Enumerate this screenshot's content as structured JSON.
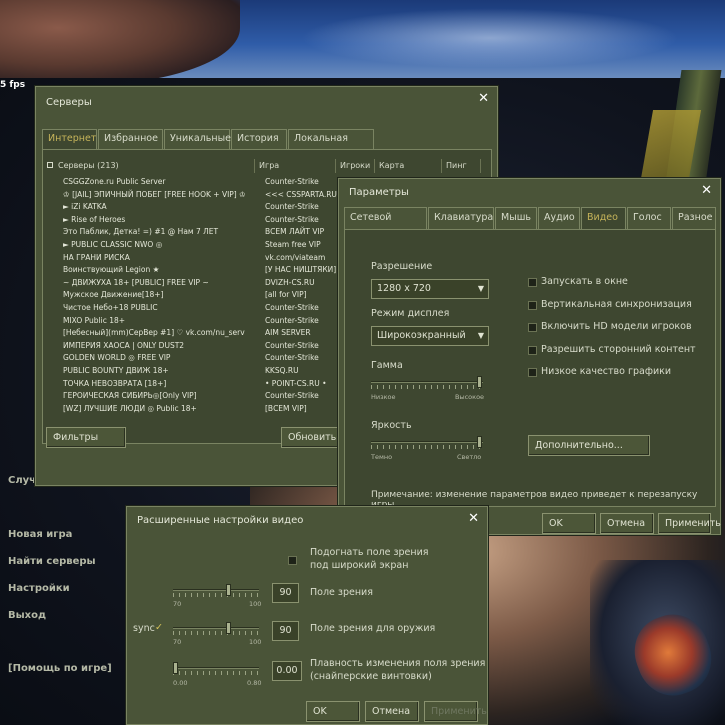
{
  "hud": {
    "fps": "5 fps"
  },
  "main_menu": {
    "items": [
      "Новая игра",
      "Найти серверы",
      "Настройки",
      "Выход"
    ],
    "help": "[Помощь по игре]",
    "partial": "Случа"
  },
  "servers": {
    "title": "Серверы",
    "tabs": [
      "Интернет",
      "Избранное",
      "Уникальные",
      "История",
      "Локальная сеть"
    ],
    "active_tab": "Интернет",
    "columns": {
      "servers": "Серверы (213)",
      "game": "Игра",
      "players": "Игроки",
      "map": "Карта",
      "ping": "Пинг"
    },
    "rows": [
      {
        "name": "CSGGZone.ru Public Server",
        "game": "Counter-Strike"
      },
      {
        "name": "♔ [JAIL] ЭПИЧНЫЙ ПОБЕГ [FREE HOOK + VIP] ♔",
        "game": "<<< CSSPARTA.RU ..."
      },
      {
        "name": "► iZi KATKA",
        "game": "Counter-Strike"
      },
      {
        "name": "► Rise of Heroes",
        "game": "Counter-Strike"
      },
      {
        "name": "Это Паблик, Детка! =) #1 @ Нам 7 ЛЕТ",
        "game": "ВСЕМ ЛАЙТ VIP"
      },
      {
        "name": "► PUBLIC CLASSIC NWO ◎",
        "game": "Steam free VIP"
      },
      {
        "name": "НА ГРАНИ РИСКА",
        "game": "vk.com/viateam"
      },
      {
        "name": "Воинствующий Legion ★",
        "game": "[У НАС НИШТЯКИ]"
      },
      {
        "name": "~ ДВИЖУХА 18+ [PUBLIC] FREE VIP ~",
        "game": "DVIZH-CS.RU"
      },
      {
        "name": "Мужское Движение[18+]",
        "game": "[all for VIP]"
      },
      {
        "name": "Чистое Небо+18 PUBLIC",
        "game": "Counter-Strike"
      },
      {
        "name": "MIXO Public 18+",
        "game": "Counter-Strike"
      },
      {
        "name": "[Небесный](mm)СерВер #1] ♡ vk.com/nu_serv",
        "game": "AIM SERVER"
      },
      {
        "name": "ИМПЕРИЯ ХАОСА | ONLY DUST2",
        "game": "Counter-Strike"
      },
      {
        "name": "GOLDEN WORLD ◎ FREE VIP",
        "game": "Counter-Strike"
      },
      {
        "name": "PUBLIC BOUNTY ДВИЖ 18+",
        "game": "KKSQ.RU"
      },
      {
        "name": "ТОЧКА НЕВОЗВРАТА [18+]",
        "game": "• POINT-CS.RU •"
      },
      {
        "name": "ГЕРОИЧЕСКАЯ СИБИРЬ◎[Only VIP]",
        "game": "Counter-Strike"
      },
      {
        "name": "[WZ] ЛУЧШИЕ ЛЮДИ ◎ Public 18+",
        "game": "[ВСЕМ VIP]"
      }
    ],
    "filters_button": "Фильтры",
    "refresh_button": "Обновить"
  },
  "params": {
    "title": "Параметры",
    "tabs": [
      "Сетевой режим",
      "Клавиатура",
      "Мышь",
      "Аудио",
      "Видео",
      "Голос",
      "Разное"
    ],
    "active_tab": "Видео",
    "resolution_label": "Разрешение",
    "resolution_value": "1280 x 720",
    "display_mode_label": "Режим дисплея",
    "display_mode_value": "Широкоэкранный",
    "gamma_label": "Гамма",
    "gamma_min": "Низкое",
    "gamma_max": "Высокое",
    "gamma_level": 1.0,
    "brightness_label": "Яркость",
    "brightness_min": "Темно",
    "brightness_max": "Светло",
    "brightness_level": 1.0,
    "checkboxes": [
      "Запускать в окне",
      "Вертикальная синхронизация",
      "Включить HD модели игроков",
      "Разрешить сторонний контент",
      "Низкое качество графики"
    ],
    "advanced_button": "Дополнительно...",
    "note": "Примечание: изменение параметров видео приведет к перезапуску игры.",
    "ok": "OK",
    "cancel": "Отмена",
    "apply": "Применить"
  },
  "adv": {
    "title": "Расширенные настройки видео",
    "widescreen_label_1": "Подогнать поле зрения",
    "widescreen_label_2": "под широкий экран",
    "fov_value": "90",
    "fov_label": "Поле зрения",
    "fov_min": "70",
    "fov_max": "100",
    "fov_level": 0.667,
    "sync_label": "sync",
    "weapon_fov_value": "90",
    "weapon_fov_label": "Поле зрения для оружия",
    "weapon_fov_min": "70",
    "weapon_fov_max": "100",
    "weapon_fov_level": 0.667,
    "smooth_value": "0.00",
    "smooth_label_1": "Плавность изменения поля зрения",
    "smooth_label_2": "(снайперские винтовки)",
    "smooth_min": "0.00",
    "smooth_max": "0.80",
    "smooth_level": 0.0,
    "ok": "OK",
    "cancel": "Отмена",
    "apply": "Применить"
  }
}
